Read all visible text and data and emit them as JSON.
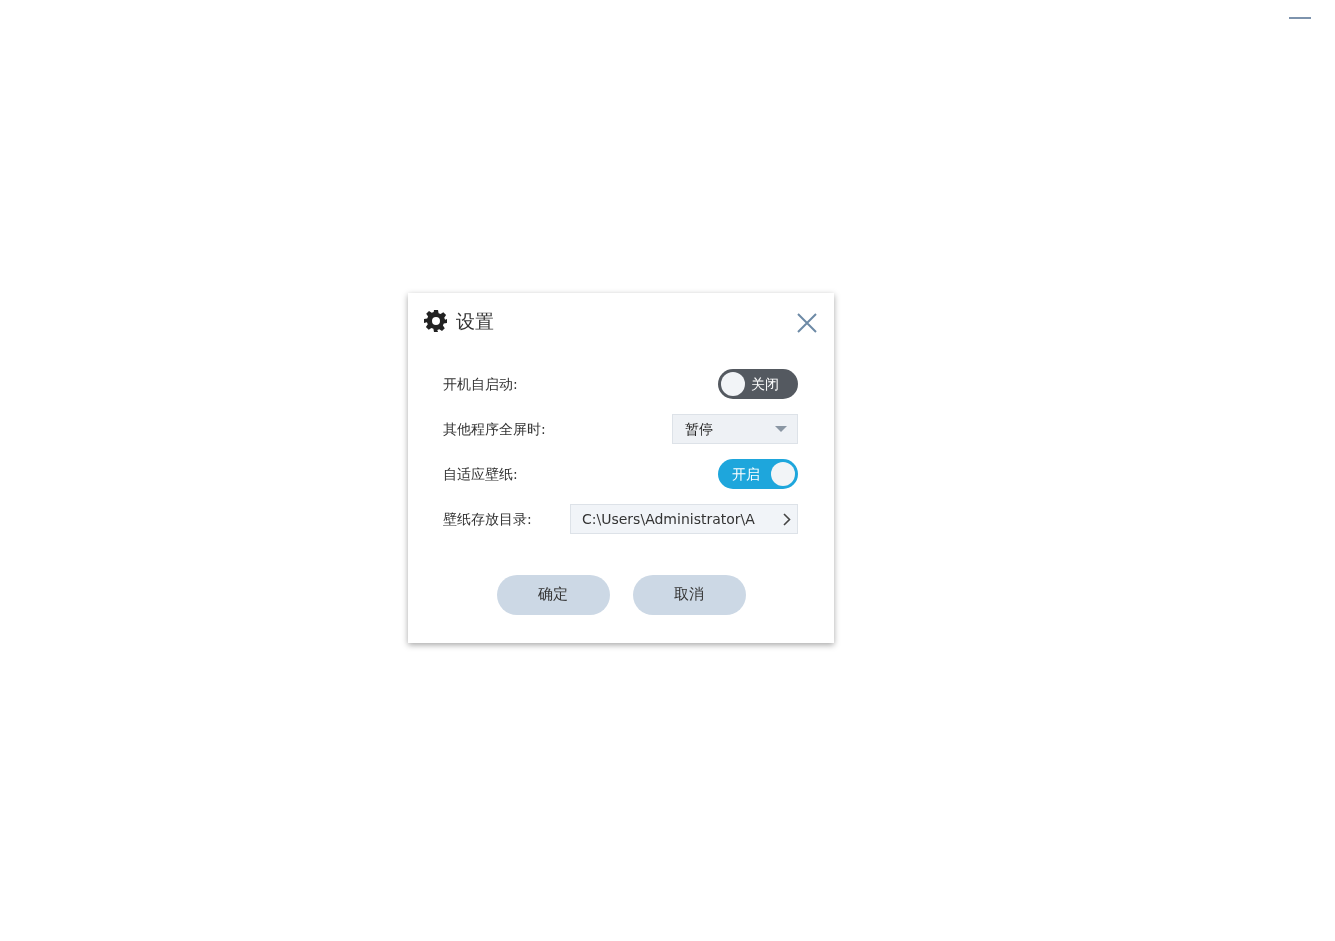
{
  "dialog": {
    "title": "设置",
    "settings": [
      {
        "kind": "toggle",
        "label": "开机自启动:",
        "on": false,
        "state_text": "关闭"
      },
      {
        "kind": "select",
        "label": "其他程序全屏时:",
        "value": "暂停"
      },
      {
        "kind": "toggle",
        "label": "自适应壁纸:",
        "on": true,
        "state_text": "开启"
      },
      {
        "kind": "path",
        "label": "壁纸存放目录:",
        "value": "C:\\Users\\Administrator\\A"
      }
    ],
    "buttons": [
      "确定",
      "取消"
    ]
  }
}
